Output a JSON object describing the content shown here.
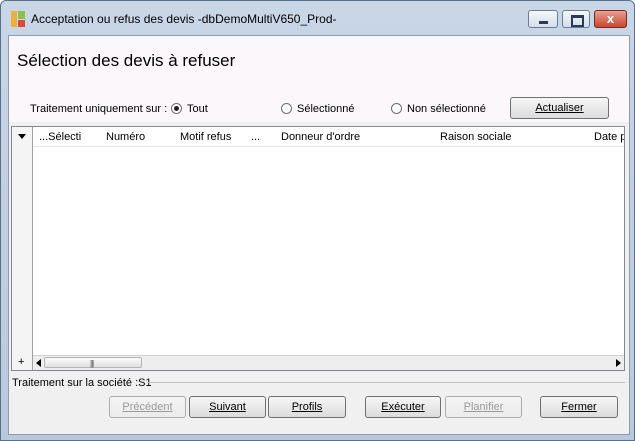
{
  "window": {
    "title": "Acceptation ou refus des devis -dbDemoMultiV650_Prod-",
    "controls": {
      "minimize": "minimize",
      "maximize": "maximize",
      "close": "x"
    }
  },
  "header": {
    "title": "Sélection des devis à refuser"
  },
  "filter": {
    "label": "Traitement uniquement sur :",
    "options": [
      {
        "label": "Tout",
        "selected": true
      },
      {
        "label": "Sélectionné",
        "selected": false
      },
      {
        "label": "Non sélectionné",
        "selected": false
      }
    ],
    "refresh_label": "Actualiser"
  },
  "grid": {
    "columns": [
      "...Sélecti",
      "Numéro",
      "Motif refus",
      "...",
      "Donneur d'ordre",
      "Raison sociale",
      "Date p"
    ],
    "rows": [],
    "add_glyph": "+",
    "thumb_grip": "|||"
  },
  "status": {
    "text": "Traitement sur la société :S1"
  },
  "footer": {
    "buttons": [
      {
        "label": "Précédent",
        "enabled": false
      },
      {
        "label": "Suivant",
        "enabled": true
      },
      {
        "label": "Profils",
        "enabled": true
      },
      {
        "label": "Exécuter",
        "enabled": true
      },
      {
        "label": "Planifier",
        "enabled": false
      },
      {
        "label": "Fermer",
        "enabled": true
      }
    ]
  },
  "colors": {
    "title_bar": "#c9d6e6",
    "close_button": "#c8452f",
    "client_background": "#f0f0f0",
    "header_background": "#fbf7fb"
  }
}
